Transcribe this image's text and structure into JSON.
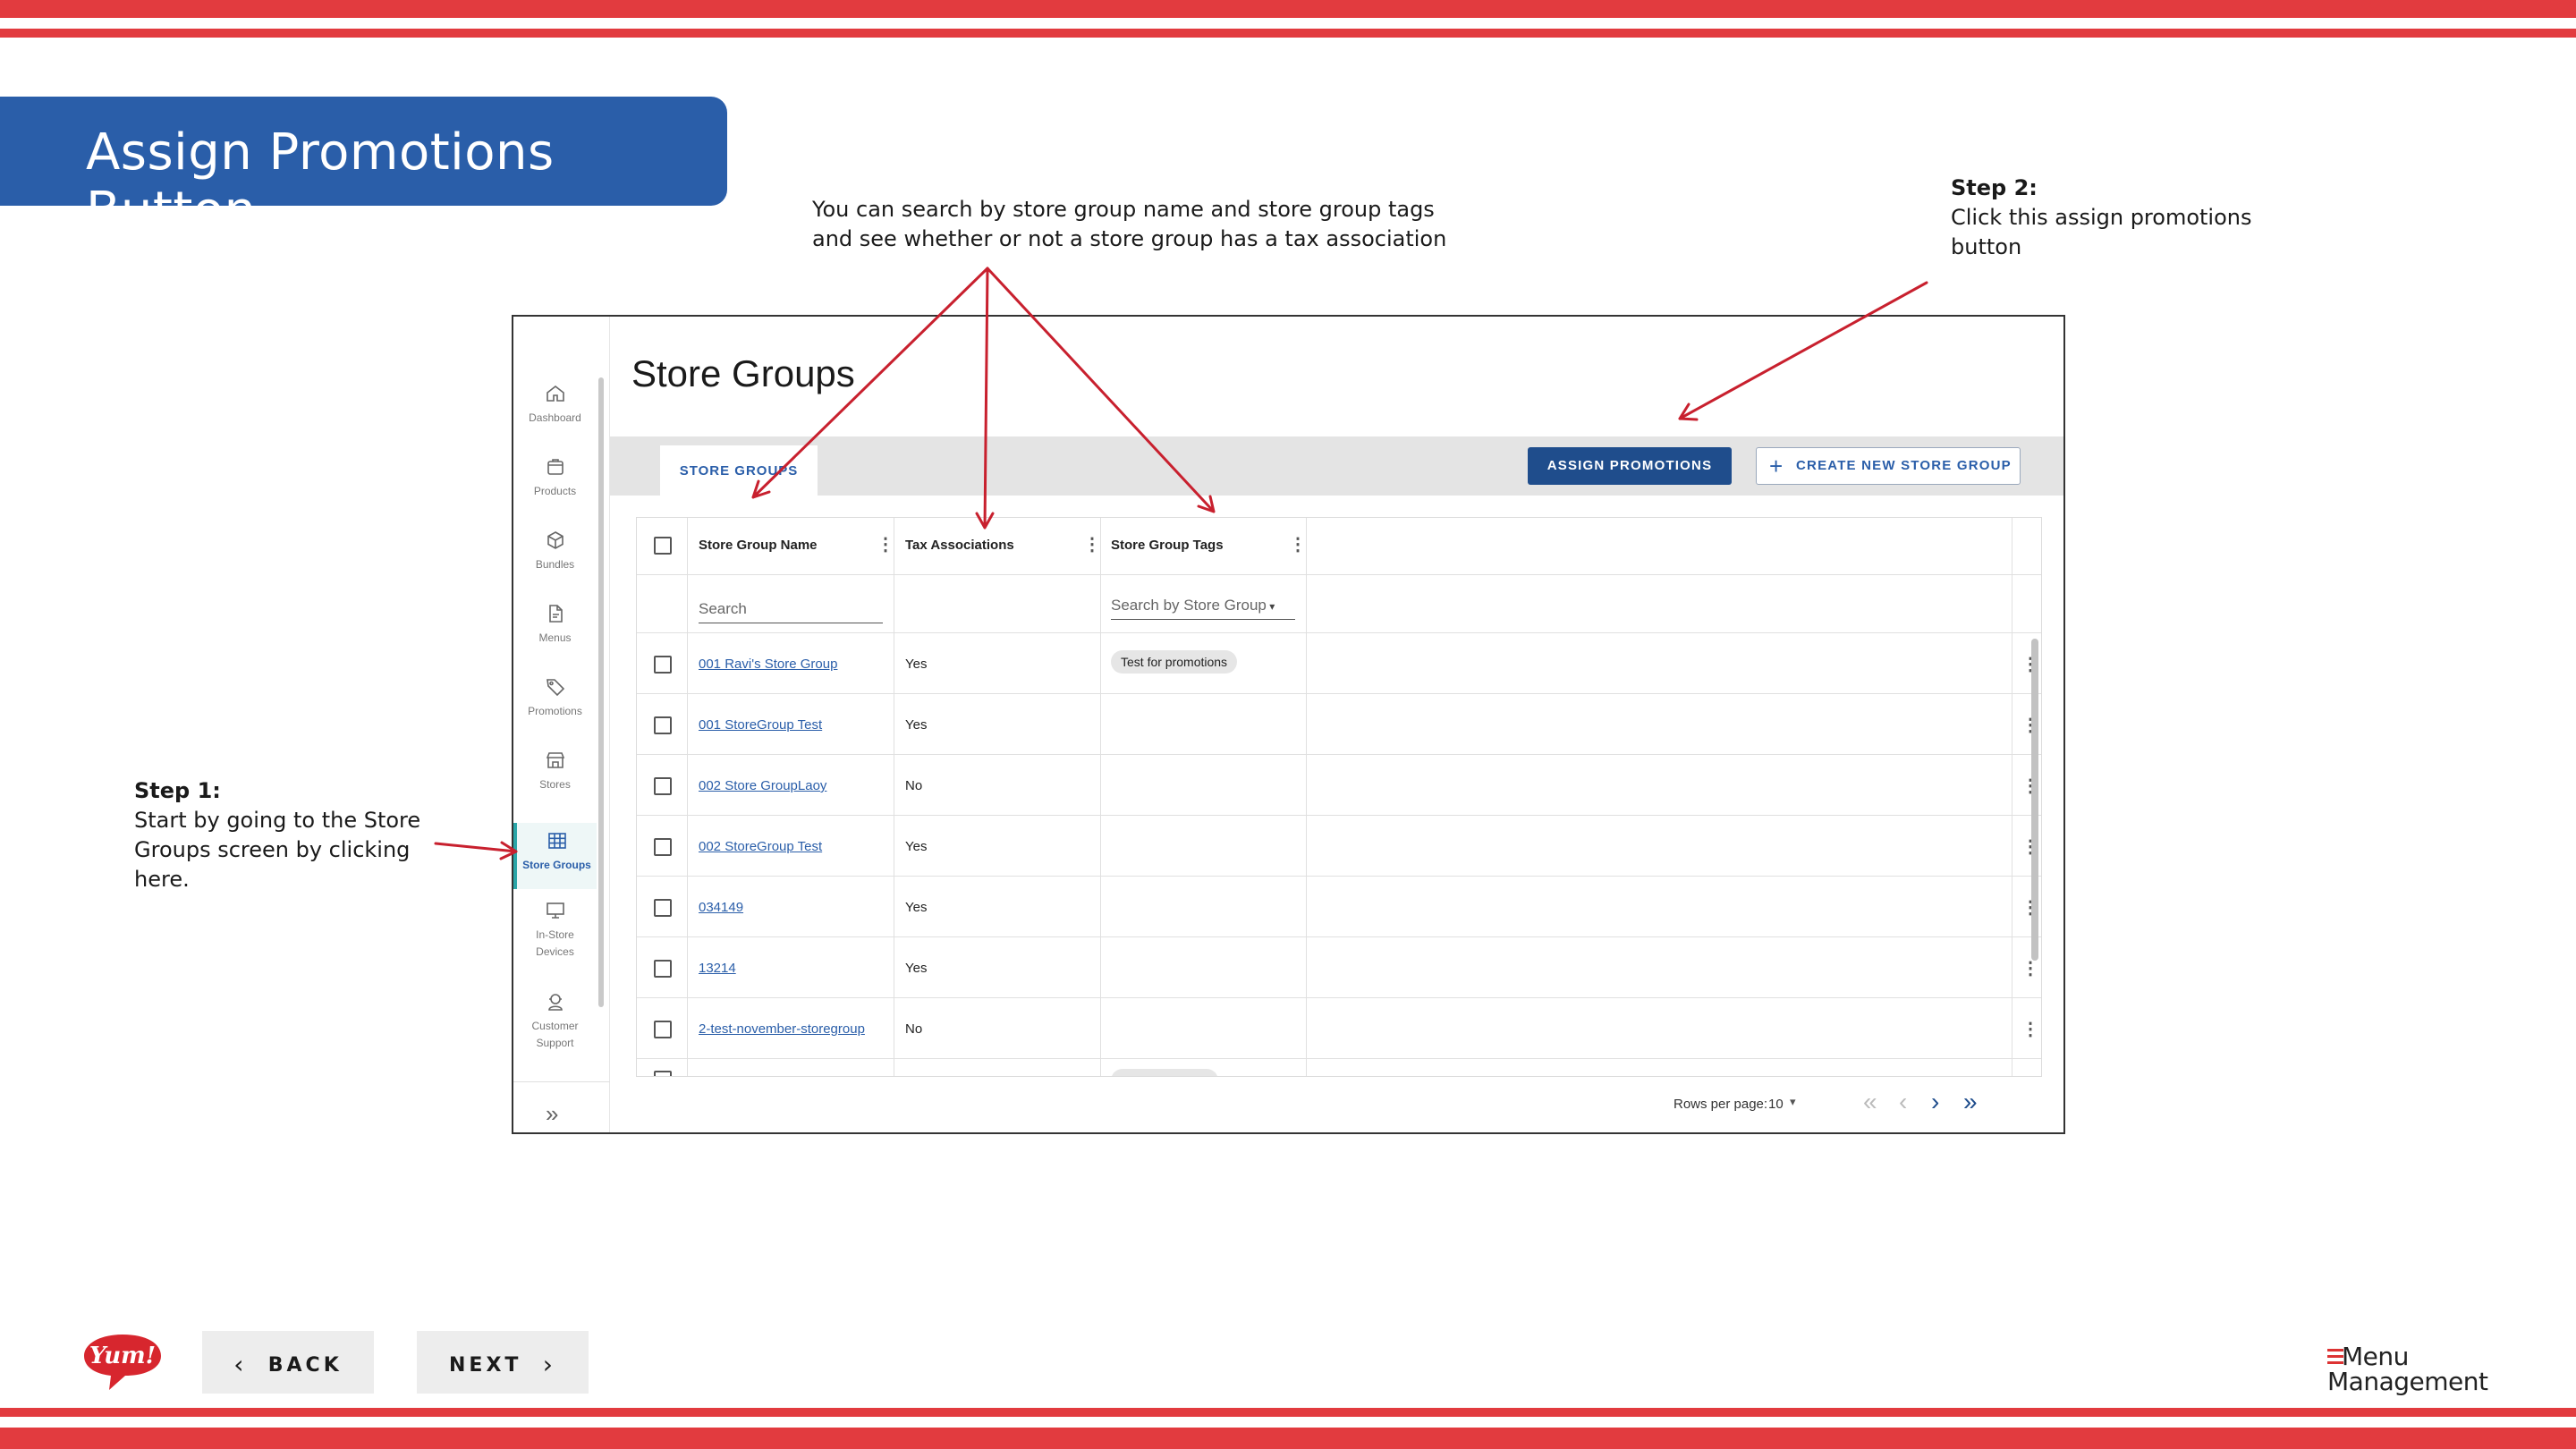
{
  "slide": {
    "title": "Assign Promotions Button",
    "search_note_line1": "You can search by store group name and store group tags",
    "search_note_line2": "and see whether or not a store group has a tax association",
    "step2_heading": "Step 2:",
    "step2_line1": "Click this assign promotions",
    "step2_line2": "button",
    "step1_heading": "Step 1:",
    "step1_line1": "Start by going to the Store",
    "step1_line2": "Groups screen by clicking",
    "step1_line3": "here.",
    "accent_color": "#e23b3f",
    "banner_color": "#2a5ea9"
  },
  "app": {
    "page_title": "Store Groups",
    "sidebar": {
      "items": [
        {
          "label": "Dashboard",
          "icon": "home-icon"
        },
        {
          "label": "Products",
          "icon": "box-icon"
        },
        {
          "label": "Bundles",
          "icon": "cube-icon"
        },
        {
          "label": "Menus",
          "icon": "document-icon"
        },
        {
          "label": "Promotions",
          "icon": "tag-icon"
        },
        {
          "label": "Stores",
          "icon": "storefront-icon"
        },
        {
          "label": "Store Groups",
          "icon": "grid-icon"
        },
        {
          "label_l1": "In-Store",
          "label_l2": "Devices",
          "icon": "monitor-icon"
        },
        {
          "label_l1": "Customer",
          "label_l2": "Support",
          "icon": "headset-icon"
        }
      ],
      "active": "Store Groups"
    },
    "tab_label": "STORE GROUPS",
    "assign_button": "ASSIGN PROMOTIONS",
    "create_button": "CREATE NEW STORE GROUP",
    "columns": {
      "name": "Store Group Name",
      "tax": "Tax Associations",
      "tags": "Store Group Tags"
    },
    "filters": {
      "name_placeholder": "Search",
      "tags_placeholder": "Search by Store Group"
    },
    "rows": [
      {
        "name": "001 Ravi's Store Group",
        "tax": "Yes",
        "tag": "Test for promotions"
      },
      {
        "name": "001 StoreGroup Test",
        "tax": "Yes",
        "tag": ""
      },
      {
        "name": "002 Store GroupLaoy",
        "tax": "No",
        "tag": ""
      },
      {
        "name": "002 StoreGroup Test",
        "tax": "Yes",
        "tag": ""
      },
      {
        "name": "034149",
        "tax": "Yes",
        "tag": ""
      },
      {
        "name": "13214",
        "tax": "Yes",
        "tag": ""
      },
      {
        "name": "2-test-november-storegroup",
        "tax": "No",
        "tag": ""
      }
    ],
    "pagination": {
      "rows_per_page_label": "Rows per page:",
      "rows_per_page_value": "10"
    }
  },
  "footer": {
    "back_label": "BACK",
    "next_label": "NEXT",
    "logo_text": "Yum!",
    "product_line1": "Menu",
    "product_line2": "Management"
  }
}
